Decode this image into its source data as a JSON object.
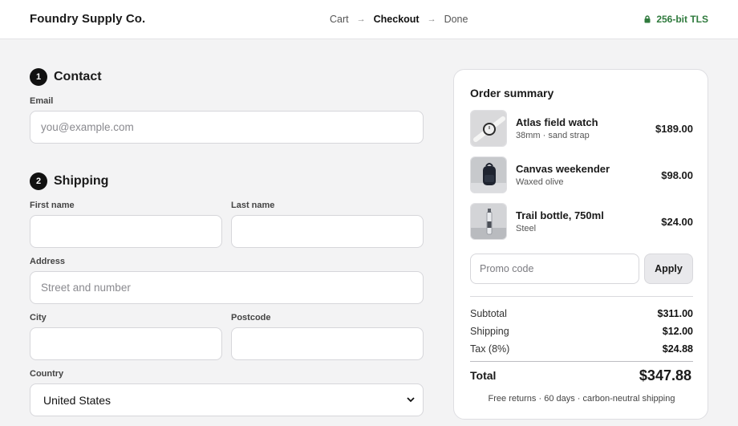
{
  "header": {
    "brand": "Foundry Supply Co.",
    "steps": [
      "Cart",
      "Checkout",
      "Done"
    ],
    "active_step": "Checkout",
    "secure_label": "256-bit TLS",
    "secure_color": "#2f7a3d"
  },
  "contact": {
    "number": "1",
    "title": "Contact",
    "email_label": "Email",
    "email_placeholder": "you@example.com",
    "email_value": ""
  },
  "shipping": {
    "number": "2",
    "title": "Shipping",
    "first_name_label": "First name",
    "last_name_label": "Last name",
    "address_label": "Address",
    "address_placeholder": "Street and number",
    "city_label": "City",
    "postcode_label": "Postcode",
    "country_label": "Country",
    "country_value": "United States"
  },
  "summary": {
    "title": "Order summary",
    "items": [
      {
        "name": "Atlas field watch",
        "detail": "38mm · sand strap",
        "price": "$189.00",
        "thumb_icon": "watch-icon"
      },
      {
        "name": "Canvas weekender",
        "detail": "Waxed olive",
        "price": "$98.00",
        "thumb_icon": "backpack-icon"
      },
      {
        "name": "Trail bottle, 750ml",
        "detail": "Steel",
        "price": "$24.00",
        "thumb_icon": "bottle-icon"
      }
    ],
    "promo_placeholder": "Promo code",
    "apply_label": "Apply",
    "subtotal_label": "Subtotal",
    "subtotal_value": "$311.00",
    "shipping_label": "Shipping",
    "shipping_value": "$12.00",
    "tax_label": "Tax (8%)",
    "tax_value": "$24.88",
    "total_label": "Total",
    "total_value": "$347.88",
    "footnote": "Free returns · 60 days · carbon-neutral shipping"
  }
}
